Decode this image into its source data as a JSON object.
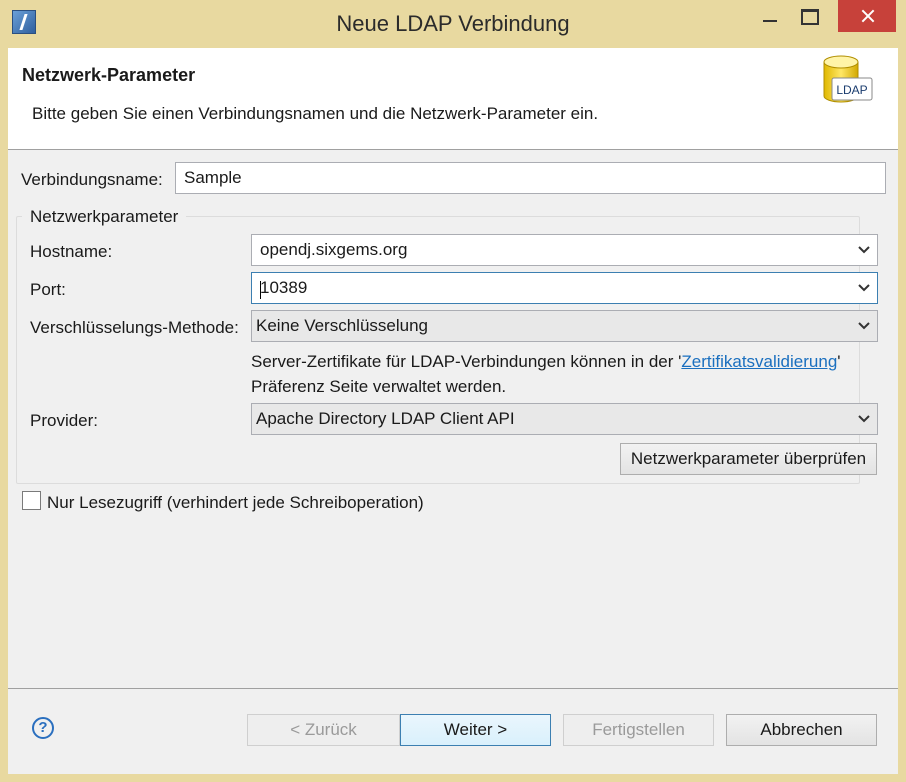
{
  "window": {
    "title": "Neue LDAP Verbindung",
    "colors": {
      "titlebar": "#e8d9a0",
      "close": "#c7413a",
      "accent": "#3c7fb1",
      "link": "#1a6fbf"
    }
  },
  "header": {
    "title": "Netzwerk-Parameter",
    "description": "Bitte geben Sie einen Verbindungsnamen und die Netzwerk-Parameter ein.",
    "icon_label": "LDAP"
  },
  "form": {
    "connection_name_label": "Verbindungsname:",
    "connection_name_value": "Sample",
    "group_title": "Netzwerkparameter",
    "hostname_label": "Hostname:",
    "hostname_value": "opendj.sixgems.org",
    "port_label": "Port:",
    "port_value": "10389",
    "encryption_label": "Verschlüsselungs-Methode:",
    "encryption_value": "Keine Verschlüsselung",
    "note_prefix": "Server-Zertifikate für LDAP-Verbindungen können in der '",
    "note_link": "Zertifikatsvalidierung",
    "note_suffix": "'",
    "note_line2": "Präferenz Seite verwaltet werden.",
    "provider_label": "Provider:",
    "provider_value": "Apache Directory LDAP Client API",
    "check_button": "Netzwerkparameter überprüfen",
    "readonly_label": "Nur Lesezugriff (verhindert jede Schreiboperation)"
  },
  "footer": {
    "help_glyph": "?",
    "back": "< Zurück",
    "next": "Weiter >",
    "finish": "Fertigstellen",
    "cancel": "Abbrechen"
  }
}
